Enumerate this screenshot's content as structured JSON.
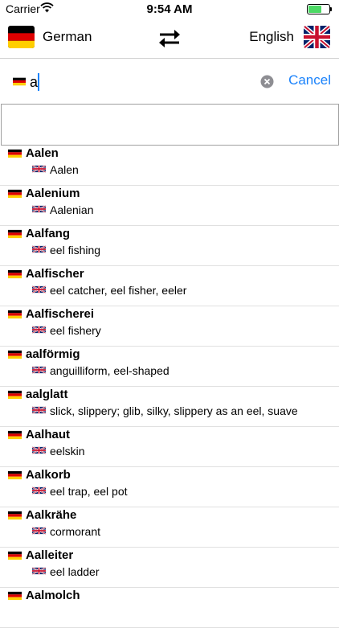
{
  "status_bar": {
    "carrier": "Carrier",
    "time": "9:54 AM"
  },
  "nav": {
    "source_language": "German",
    "target_language": "English"
  },
  "search": {
    "query": "a",
    "cancel_label": "Cancel"
  },
  "colors": {
    "accent": "#1a82fb",
    "battery": "#4cd964"
  },
  "results": [
    {
      "term": "Aalen",
      "translation": "Aalen"
    },
    {
      "term": "Aalenium",
      "translation": "Aalenian"
    },
    {
      "term": "Aalfang",
      "translation": "eel fishing"
    },
    {
      "term": "Aalfischer",
      "translation": "eel catcher, eel fisher, eeler"
    },
    {
      "term": "Aalfischerei",
      "translation": "eel fishery"
    },
    {
      "term": "aalförmig",
      "translation": "anguilliform, eel-shaped"
    },
    {
      "term": "aalglatt",
      "translation": "slick, slippery; glib, silky, slippery as an eel, suave"
    },
    {
      "term": "Aalhaut",
      "translation": "eelskin"
    },
    {
      "term": "Aalkorb",
      "translation": "eel trap, eel pot"
    },
    {
      "term": "Aalkrähe",
      "translation": "cormorant"
    },
    {
      "term": "Aalleiter",
      "translation": "eel ladder"
    },
    {
      "term": "Aalmolch",
      "translation": ""
    }
  ]
}
